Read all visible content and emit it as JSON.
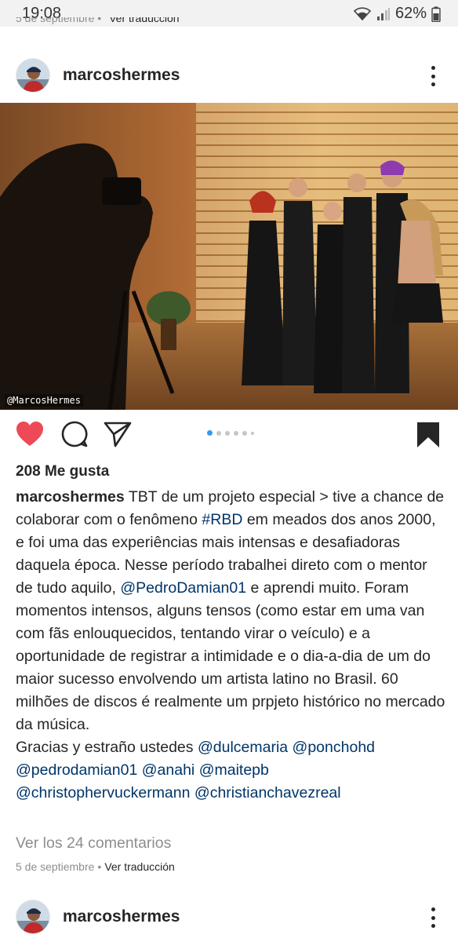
{
  "status_bar": {
    "time": "19:08",
    "battery": "62%"
  },
  "previous_post": {
    "date": "5 de septiembre",
    "separator": "•",
    "translate": "Ver traducción"
  },
  "post": {
    "username": "marcoshermes",
    "watermark": "@MarcosHermes",
    "carousel": {
      "count": 7,
      "active_index": 1
    },
    "liked": true,
    "saved": true,
    "likes_text": "208 Me gusta",
    "caption": {
      "username": "marcoshermes",
      "p1_before_hashtag": " TBT de um projeto especial > tive a chance de colaborar com o fenômeno ",
      "hashtag": "#RBD",
      "p1_after_hashtag": " em meados dos anos 2000, e foi uma das experiências mais intensas e desafiadoras daquela época. Nesse período trabalhei direto com o mentor de tudo aquilo, ",
      "mention_main": "@PedroDamian01",
      "p1_end": " e aprendi muito. Foram momentos intensos, alguns tensos (como estar em uma van com fãs enlouquecidos, tentando virar o veículo) e a oportunidade de registrar a intimidade e o dia-a-dia de um do maior sucesso envolvendo um artista latino no Brasil. 60 milhões de discos é realmente um prpjeto histórico no mercado da música.",
      "p2_start": "Gracias y estraño ustedes ",
      "mentions": [
        "@dulcemaria",
        "@ponchohd",
        "@pedrodamian01",
        "@anahi",
        "@maitepb",
        "@christophervuckermann",
        "@christianchavezreal"
      ]
    },
    "view_comments": "Ver los 24 comentarios",
    "date": "5 de septiembre",
    "separator": "•",
    "translate": "Ver traducción"
  },
  "next_post": {
    "username": "marcoshermes"
  },
  "colors": {
    "like_red": "#ed4956",
    "link_blue": "#003569",
    "dot_active": "#3897f0",
    "muted": "#8e8e8e"
  },
  "icons": [
    "wifi-icon",
    "signal-icon",
    "battery-icon",
    "more-vertical-icon",
    "heart-icon",
    "comment-icon",
    "share-icon",
    "bookmark-icon"
  ]
}
